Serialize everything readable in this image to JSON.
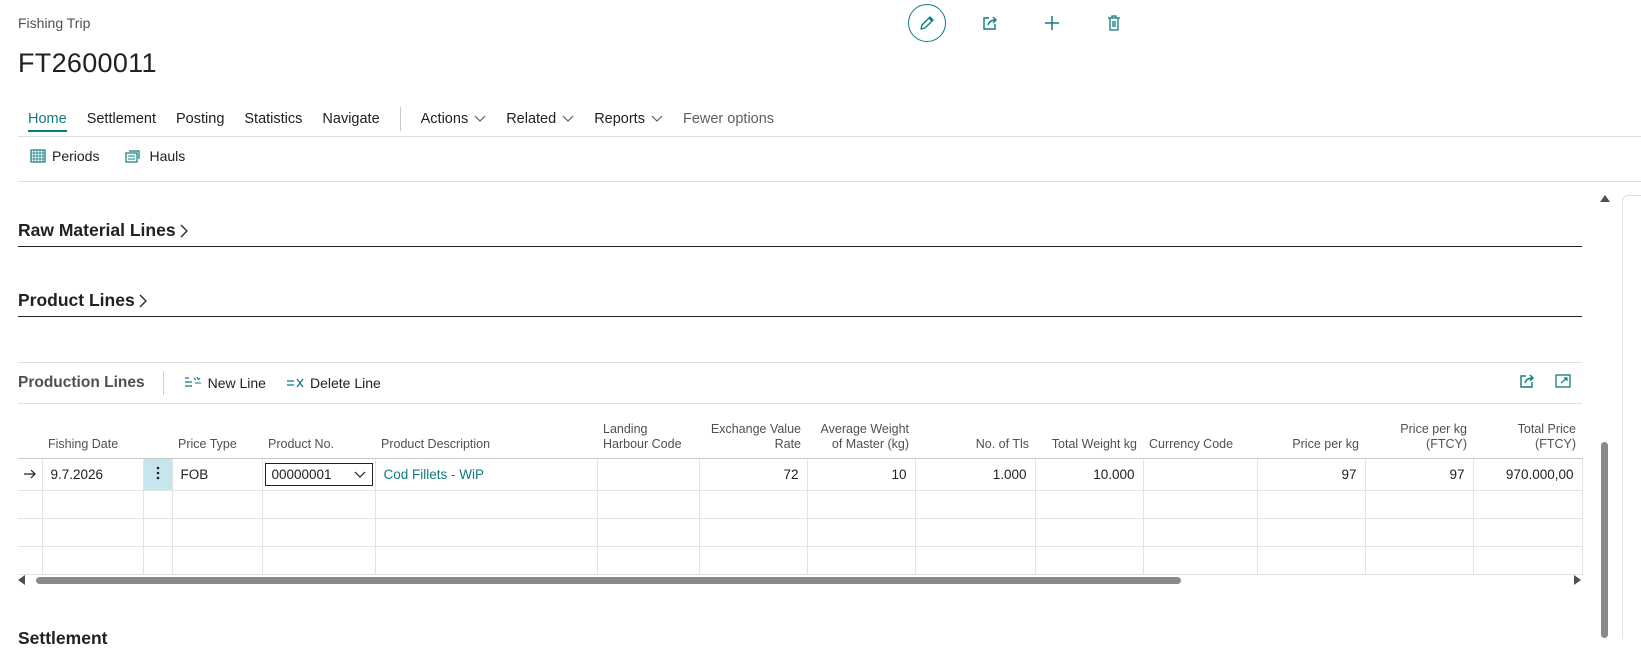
{
  "header": {
    "breadcrumb": "Fishing Trip",
    "record_no": "FT2600011"
  },
  "top_actions": [
    "edit",
    "share",
    "new",
    "delete"
  ],
  "menu": {
    "home": "Home",
    "settlement": "Settlement",
    "posting": "Posting",
    "statistics": "Statistics",
    "navigate": "Navigate",
    "actions": "Actions",
    "related": "Related",
    "reports": "Reports",
    "fewer": "Fewer options"
  },
  "sub_actions": {
    "periods": "Periods",
    "hauls": "Hauls"
  },
  "sections": {
    "raw_material": "Raw Material Lines",
    "product_lines": "Product Lines",
    "settlement": "Settlement"
  },
  "production": {
    "title": "Production Lines",
    "new_line": "New Line",
    "delete_line": "Delete Line",
    "columns": {
      "fishing_date": "Fishing Date",
      "price_type": "Price Type",
      "product_no": "Product No.",
      "product_description": "Product Description",
      "landing_harbour_1": "Landing",
      "landing_harbour_2": "Harbour Code",
      "exchange_1": "Exchange Value",
      "exchange_2": "Rate",
      "avg_weight_1": "Average Weight",
      "avg_weight_2": "of Master (kg)",
      "no_of_tls": "No. of Tls",
      "total_weight": "Total Weight kg",
      "currency_code": "Currency Code",
      "price_per_kg": "Price per kg",
      "price_per_kg_ftcy_1": "Price per kg",
      "price_per_kg_ftcy_2": "(FTCY)",
      "total_price_1": "Total Price",
      "total_price_2": "(FTCY)"
    },
    "row": {
      "fishing_date": "9.7.2026",
      "price_type": "FOB",
      "product_no": "00000001",
      "product_description": "Cod Fillets - WiP",
      "landing_harbour_code": "",
      "exchange_value_rate": "72",
      "avg_weight": "10",
      "no_of_tls": "1.000",
      "total_weight": "10.000",
      "currency_code": "",
      "price_per_kg": "97",
      "price_per_kg_ftcy": "97",
      "total_price_ftcy": "970.000,00"
    }
  },
  "colors": {
    "accent": "#0f7b80",
    "selected_cell": "#c6e6ee"
  }
}
